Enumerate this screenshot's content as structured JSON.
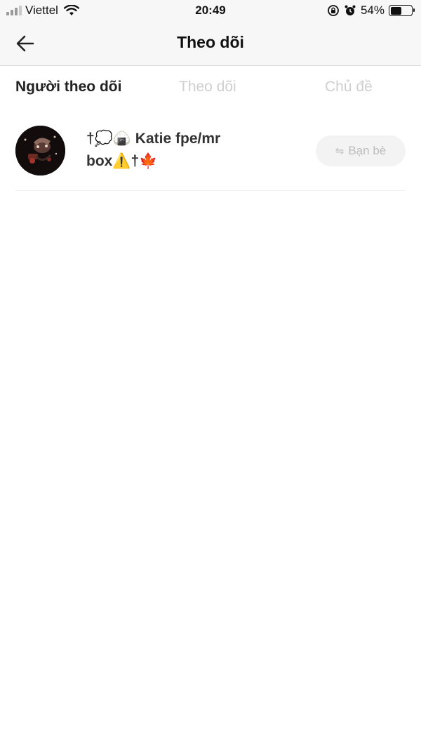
{
  "status_bar": {
    "carrier": "Viettel",
    "time": "20:49",
    "battery_percent": "54%",
    "battery_level": 0.54,
    "icons": [
      "signal-icon",
      "wifi-icon",
      "rotation-lock-icon",
      "alarm-icon",
      "battery-icon"
    ]
  },
  "nav": {
    "title": "Theo dõi",
    "back_icon": "arrow-left-icon"
  },
  "tabs": [
    {
      "label": "Người theo dõi",
      "active": true
    },
    {
      "label": "Theo dõi",
      "active": false
    },
    {
      "label": "Chủ đề",
      "active": false
    }
  ],
  "followers": [
    {
      "name": "†💭🍙 Katie fpe/mr box⚠️†🍁",
      "avatar": "avatar-image",
      "action_label": "Bạn bè",
      "action_icon": "swap-arrows-icon"
    }
  ],
  "colors": {
    "header_bg": "#f7f7f7",
    "active_tab": "#222222",
    "inactive_tab": "#cfcfcf",
    "friend_button_bg": "#f3f3f3",
    "friend_button_text": "#bdbdbd"
  }
}
